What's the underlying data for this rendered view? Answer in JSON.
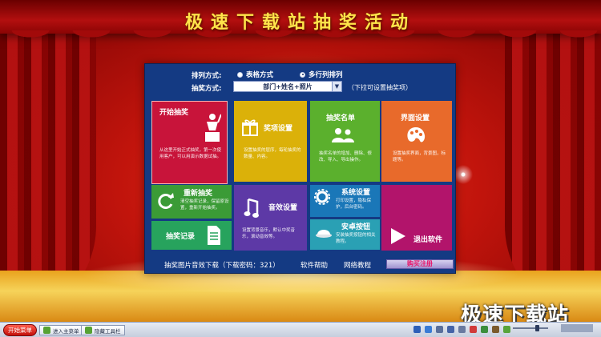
{
  "banner": {
    "title": "极速下载站抽奖活动"
  },
  "options": {
    "arrange_label": "排列方式:",
    "radio_table": "表格方式",
    "radio_multirow": "多行列排列",
    "radio_selected": "多行列排列",
    "draw_label": "抽奖方式:",
    "draw_value": "部门+姓名+照片",
    "draw_hint": "（下拉可设置抽奖项）"
  },
  "tiles": {
    "start": {
      "title": "开始抽奖",
      "desc": "从这里开始正式抽奖，第一次使用客户，可以用演示数据试抽。",
      "color": "#c8143a"
    },
    "prize": {
      "title": "奖项设置",
      "desc": "设置抽奖的层序，每轮抽奖的数量、内容。",
      "color": "#dbb109"
    },
    "list": {
      "title": "抽奖名单",
      "desc": "抽奖名单的增加、删除、修改、导入、导出操作。",
      "color": "#5bb02d"
    },
    "ui": {
      "title": "界面设置",
      "desc": "设置抽奖界面，背景图，标题等。",
      "color": "#e86a2b"
    },
    "restart": {
      "title": "重新抽奖",
      "desc": "清空抽奖记录，保留原设置，重新开始抽奖。",
      "color": "#3b9b36"
    },
    "record": {
      "title": "抽奖记录",
      "color": "#27a35d"
    },
    "sound": {
      "title": "音效设置",
      "desc": "设置背景音乐，默认中奖音乐，滚动音效等。",
      "color": "#5d39a6"
    },
    "system": {
      "title": "系统设置",
      "desc": "打印设置，隐私保护，后台密码。",
      "color": "#1a77b8"
    },
    "security": {
      "title": "安卓按钮",
      "desc": "安装抽奖按钮的相关教程。",
      "color": "#2aa0b4"
    },
    "exit": {
      "title": "退出软件",
      "color": "#b2146b"
    }
  },
  "bottom": {
    "download": "抽奖图片音效下载（下载密码：321）",
    "help": "软件帮助",
    "tutorial": "网络教程",
    "buy": "购买注册"
  },
  "watermark": "极速下载站",
  "taskbar": {
    "start": "开始菜单",
    "task1": "进入主菜单",
    "task2": "隐藏工具栏",
    "volume_level": 0.72
  },
  "colors": {
    "window": "#143a83",
    "title": "#ffe44a"
  }
}
